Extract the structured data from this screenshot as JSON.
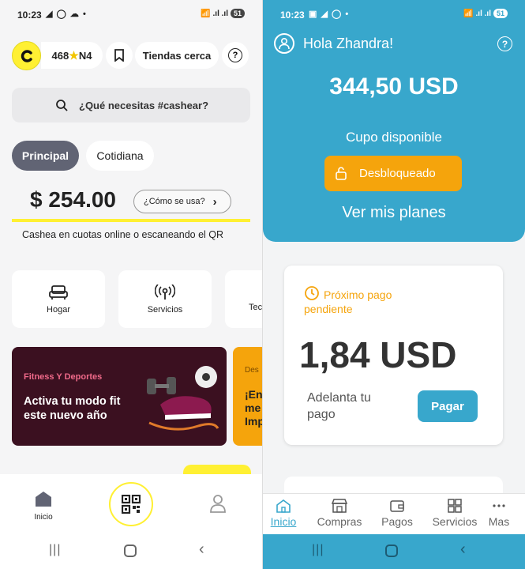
{
  "left": {
    "status": {
      "time": "10:23",
      "icons": "◢ ◯ ☁ •",
      "right": "📶 .ıl .ıl",
      "battery": "51"
    },
    "header": {
      "points": "468",
      "level": "N4",
      "stores_button": "Tiendas cerca",
      "help_icon": "?"
    },
    "search": {
      "placeholder": "¿Qué necesitas #cashear?"
    },
    "tabs": [
      {
        "label": "Principal",
        "active": true
      },
      {
        "label": "Cotidiana",
        "active": false
      }
    ],
    "balance": {
      "amount": "$ 254.00",
      "how_button": "¿Cómo se usa?",
      "subtitle": "Cashea en cuotas online o escaneando el QR"
    },
    "categories": [
      {
        "label": "Hogar",
        "icon": "sofa-icon"
      },
      {
        "label": "Servicios",
        "icon": "broadcast-icon"
      },
      {
        "label": "Tec",
        "icon": "tech-icon"
      }
    ],
    "promo": {
      "tag": "Fitness Y Deportes",
      "title_line1": "Activa tu modo fit",
      "title_line2": "este nuevo año",
      "second_tag": "Des",
      "second_lines": [
        "¡En",
        "me",
        "Imp"
      ]
    },
    "bottom_nav": {
      "home_label": "Inicio"
    }
  },
  "right": {
    "status": {
      "time": "10:23",
      "icons": "▣ ◢ ◯ •",
      "right": "📶 .ıl .ıl",
      "battery": "51"
    },
    "greeting": "Hola Zhandra!",
    "help_icon": "?",
    "credit": {
      "amount": "344,50 USD",
      "label": "Cupo disponible",
      "status_button": "Desbloqueado",
      "plans_link": "Ver mis planes"
    },
    "payment": {
      "label_line1": "Próximo pago",
      "label_line2": "pendiente",
      "amount": "1,84 USD",
      "advance_line1": "Adelanta tu",
      "advance_line2": "pago",
      "pay_button": "Pagar"
    },
    "nav": [
      {
        "label": "Inicio",
        "active": true
      },
      {
        "label": "Compras"
      },
      {
        "label": "Pagos"
      },
      {
        "label": "Servicios"
      },
      {
        "label": "Mas"
      }
    ]
  },
  "colors": {
    "yellow": "#fff033",
    "teal": "#38a7cc",
    "orange": "#f5a40c",
    "promo_bg": "#3b1020",
    "tab_active": "#616474"
  }
}
